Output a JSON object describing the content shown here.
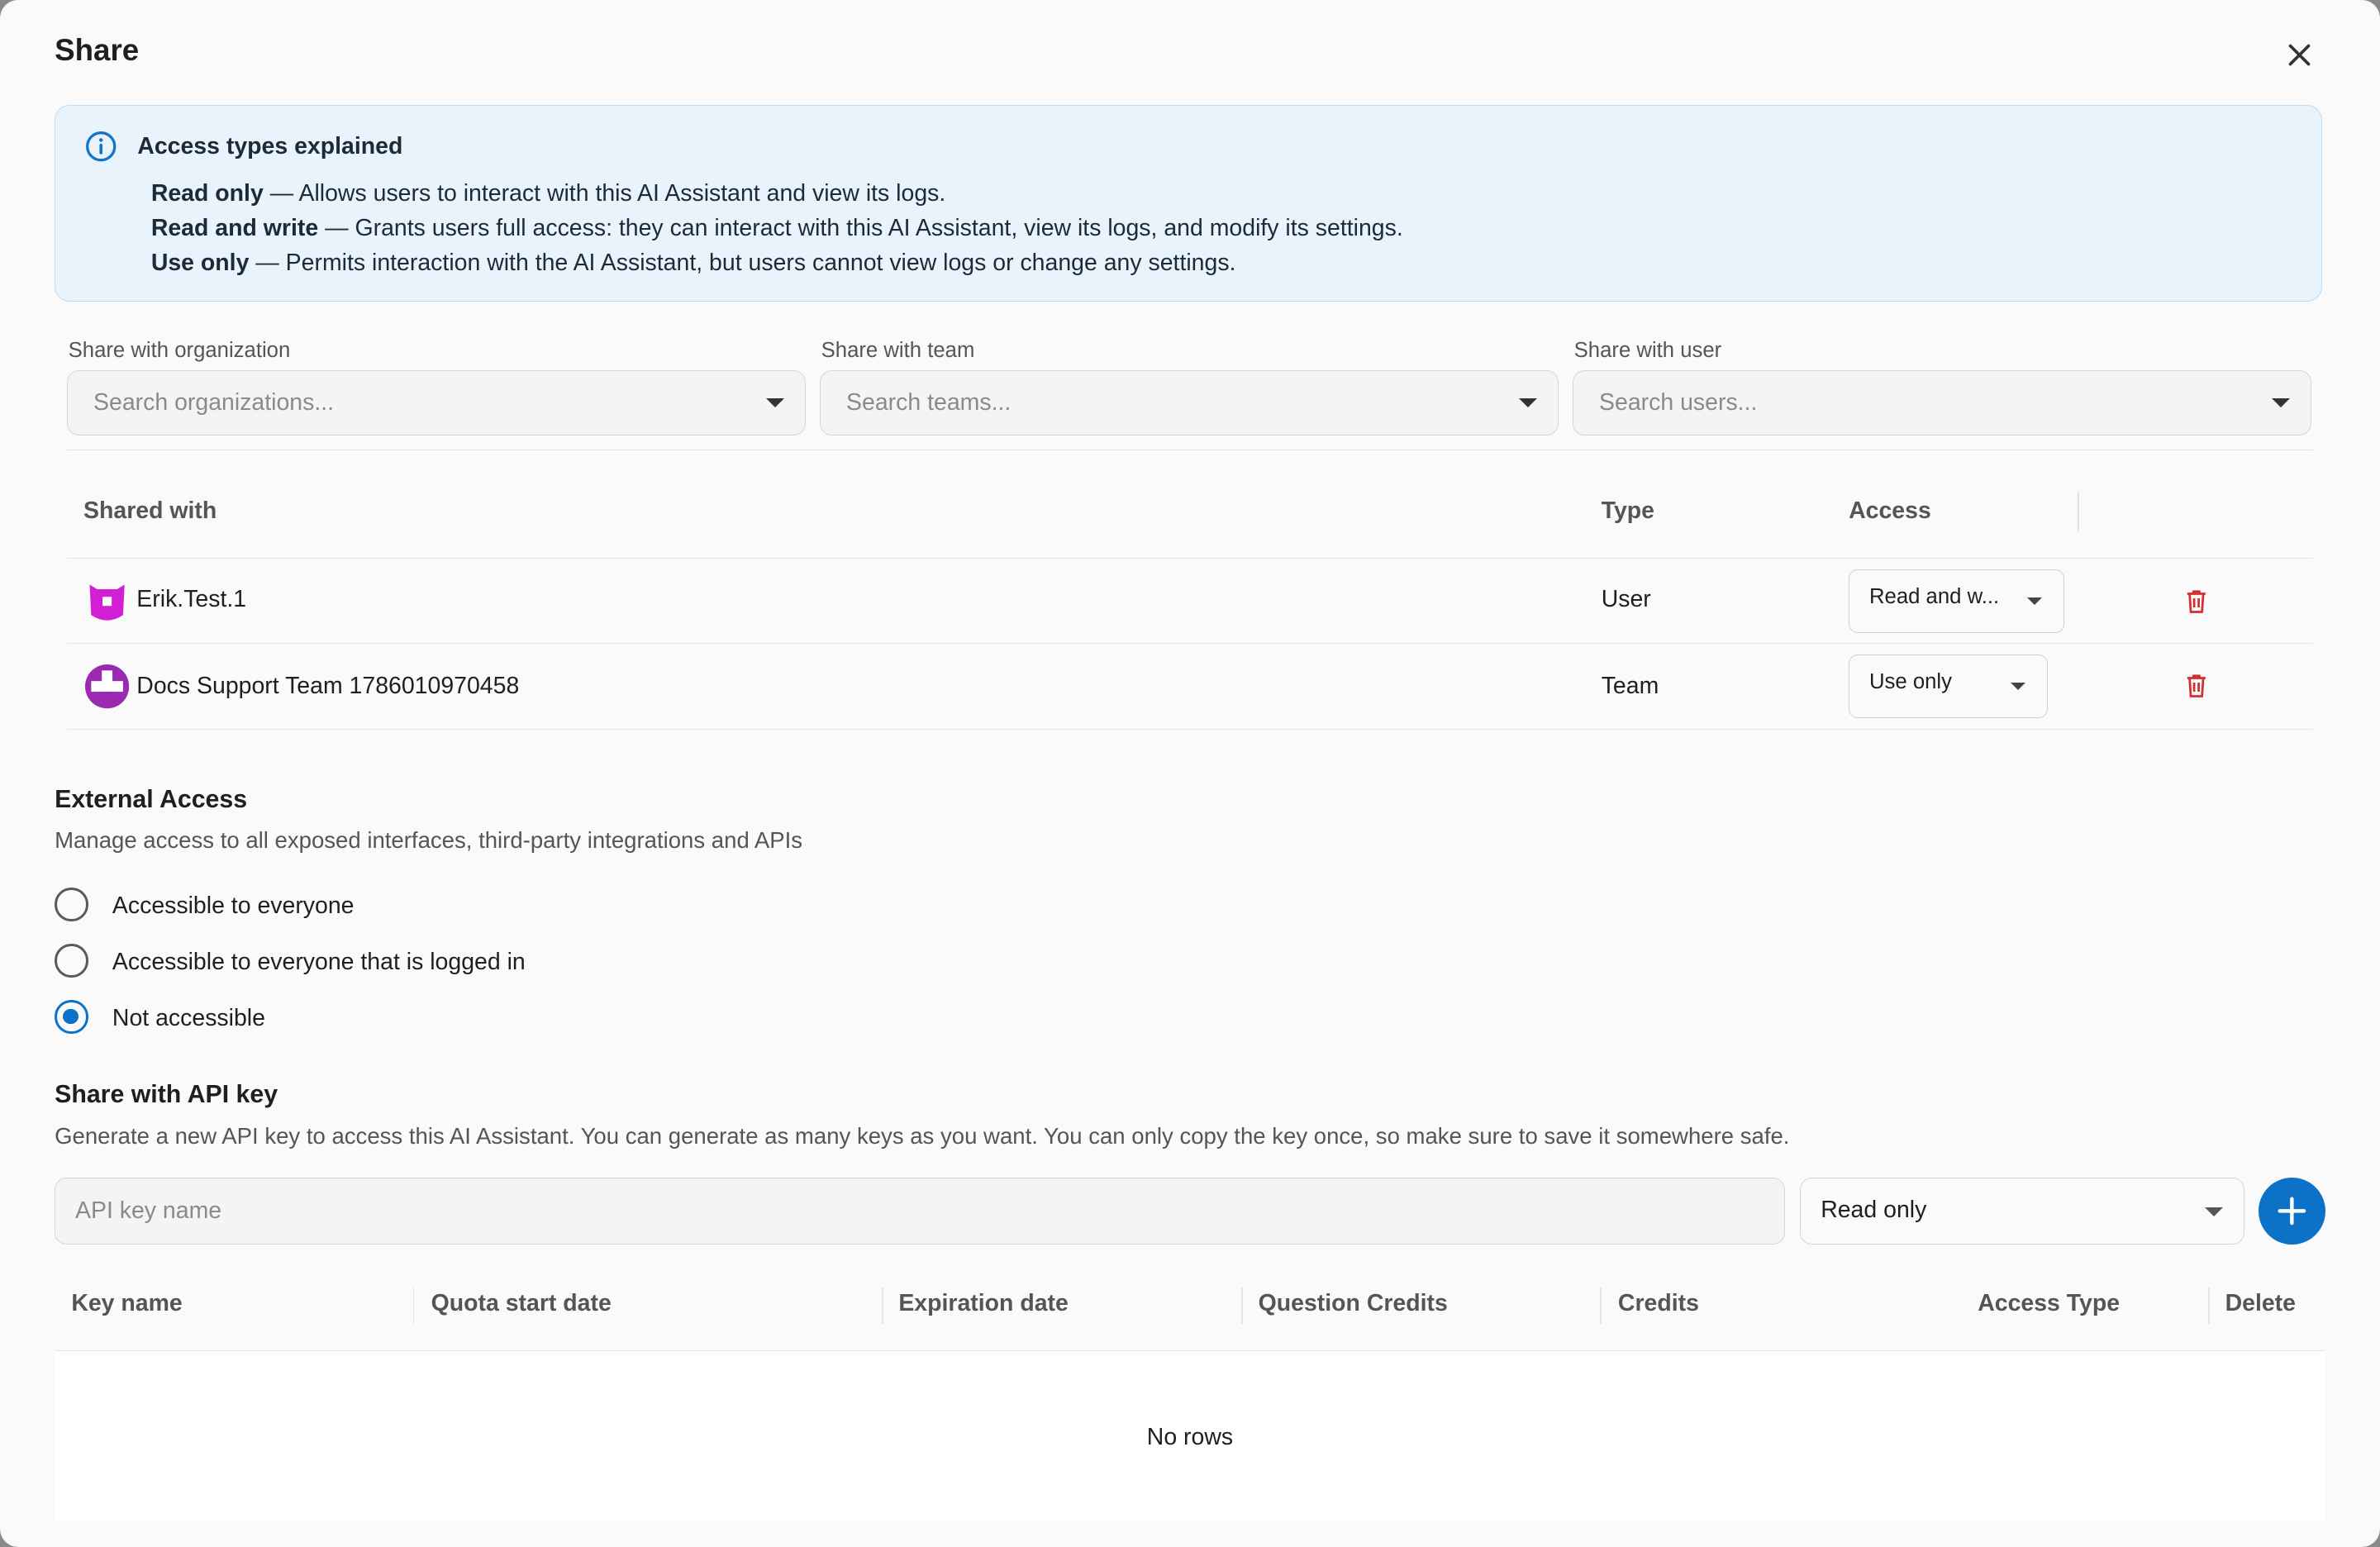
{
  "dialog": {
    "title": "Share"
  },
  "info": {
    "heading": "Access types explained",
    "items": [
      {
        "term": "Read only",
        "desc": " — Allows users to interact with this AI Assistant and view its logs."
      },
      {
        "term": "Read and write",
        "desc": " — Grants users full access: they can interact with this AI Assistant, view its logs, and modify its settings."
      },
      {
        "term": "Use only",
        "desc": " — Permits interaction with the AI Assistant, but users cannot view logs or change any settings."
      }
    ]
  },
  "share_fields": {
    "organization": {
      "label": "Share with organization",
      "placeholder": "Search organizations..."
    },
    "team": {
      "label": "Share with team",
      "placeholder": "Search teams..."
    },
    "user": {
      "label": "Share with user",
      "placeholder": "Search users..."
    }
  },
  "shared_table": {
    "headers": {
      "shared_with": "Shared with",
      "type": "Type",
      "access": "Access"
    },
    "rows": [
      {
        "name": "Erik.Test.1",
        "type": "User",
        "access": "Read and w...",
        "avatar_color": "#d21fd6"
      },
      {
        "name": "Docs Support Team 1786010970458",
        "type": "Team",
        "access": "Use only",
        "avatar_color": "#9a2bb0"
      }
    ]
  },
  "external_access": {
    "title": "External Access",
    "subtitle": "Manage access to all exposed interfaces, third-party integrations and APIs",
    "options": [
      {
        "label": "Accessible to everyone",
        "selected": false
      },
      {
        "label": "Accessible to everyone that is logged in",
        "selected": false
      },
      {
        "label": "Not accessible",
        "selected": true
      }
    ]
  },
  "api_key": {
    "title": "Share with API key",
    "subtitle": "Generate a new API key to access this AI Assistant. You can generate as many keys as you want. You can only copy the key once, so make sure to save it somewhere safe.",
    "name_placeholder": "API key name",
    "access_value": "Read only",
    "table_headers": [
      "Key name",
      "Quota start date",
      "Expiration date",
      "Question Credits",
      "Credits",
      "Access Type",
      "Delete"
    ],
    "empty_text": "No rows"
  },
  "colors": {
    "accent": "#0b72c8",
    "info_bg": "#e8f3fc",
    "danger": "#d32f2f"
  }
}
